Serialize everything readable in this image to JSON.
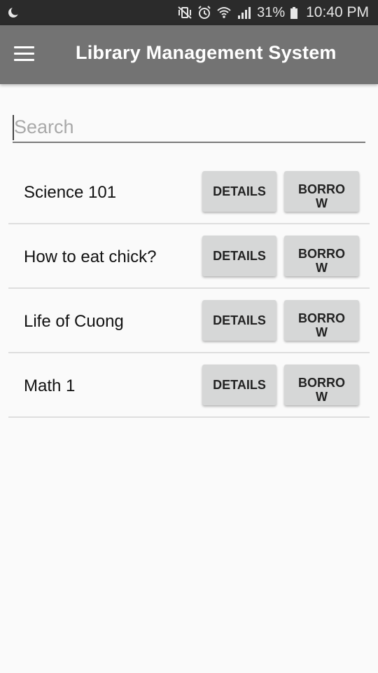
{
  "status_bar": {
    "battery_percent": "31%",
    "time": "10:40 PM",
    "icons": [
      "moon-icon",
      "mute-vibrate-icon",
      "alarm-icon",
      "wifi-icon",
      "signal-icon",
      "battery-icon"
    ]
  },
  "app_bar": {
    "title": "Library Management System",
    "menu_icon": "hamburger-menu-icon"
  },
  "search": {
    "placeholder": "Search",
    "value": ""
  },
  "books": [
    {
      "title": "Science 101",
      "details_label": "DETAILS",
      "borrow_label_line1": "BORRO",
      "borrow_label_line2": "W"
    },
    {
      "title": "How to eat chick?",
      "details_label": "DETAILS",
      "borrow_label_line1": "BORRO",
      "borrow_label_line2": "W"
    },
    {
      "title": "Life of Cuong",
      "details_label": "DETAILS",
      "borrow_label_line1": "BORRO",
      "borrow_label_line2": "W"
    },
    {
      "title": "Math 1",
      "details_label": "DETAILS",
      "borrow_label_line1": "BORRO",
      "borrow_label_line2": "W"
    }
  ],
  "colors": {
    "status_bar": "#2b2b2b",
    "app_bar": "#737373",
    "background": "#fafafa",
    "button": "#d6d7d7",
    "divider": "#dedede"
  }
}
